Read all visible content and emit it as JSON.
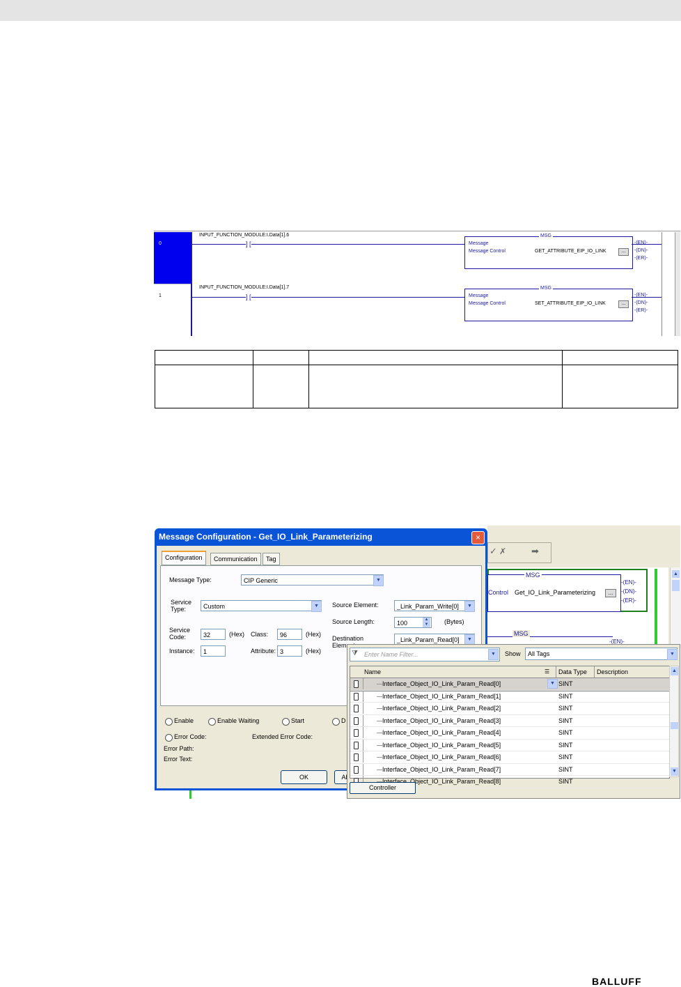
{
  "ladder": {
    "rungs": [
      {
        "number": "0",
        "contact": "INPUT_FUNCTION_MODULE:I.Data[1].6",
        "instr": "MSG",
        "l1": "Message",
        "l2": "Message Control",
        "tag": "GET_ATTRIBUTE_EIP_IO_LINK",
        "btn": "...",
        "outs": [
          "EN",
          "DN",
          "ER"
        ]
      },
      {
        "number": "1",
        "contact": "INPUT_FUNCTION_MODULE:I.Data[1].7",
        "instr": "MSG",
        "l1": "Message",
        "l2": "Message Control",
        "tag": "SET_ATTRIBUTE_EIP_IO_LINK",
        "btn": "...",
        "outs": [
          "EN",
          "DN",
          "ER"
        ]
      }
    ]
  },
  "dialog": {
    "title": "Message Configuration - Get_IO_Link_Parameterizing",
    "close": "×",
    "tabs": [
      "Configuration",
      "Communication",
      "Tag"
    ],
    "message_type_label": "Message Type:",
    "message_type_value": "CIP Generic",
    "service_type_label_1": "Service",
    "service_type_label_2": "Type:",
    "service_type_value": "Custom",
    "service_code_label_1": "Service",
    "service_code_label_2": "Code:",
    "service_code_value": "32",
    "hex1": "(Hex)",
    "class_label": "Class:",
    "class_value": "96",
    "hex2": "(Hex)",
    "instance_label": "Instance:",
    "instance_value": "1",
    "attribute_label": "Attribute:",
    "attribute_value": "3",
    "hex3": "(Hex)",
    "source_element_label": "Source Element:",
    "source_element_value": "_Link_Param_Write[0]",
    "source_length_label": "Source Length:",
    "source_length_value": "100",
    "bytes_label": "(Bytes)",
    "dest_label_1": "Destination",
    "dest_label_2": "Element:",
    "dest_value": "_Link_Param_Read[0]",
    "status": [
      "Enable",
      "Enable Waiting",
      "Start",
      "D"
    ],
    "error_code_label": "Error Code:",
    "extended_error_label": "Extended Error Code:",
    "error_path_label": "Error Path:",
    "error_text_label": "Error Text:",
    "ok": "OK",
    "abort": "Ab"
  },
  "bg_ladder": {
    "msg": "MSG",
    "control": "Control",
    "tag": "Get_IO_Link_Parameterizing",
    "btn": "...",
    "outs": [
      "EN",
      "DN",
      "ER"
    ],
    "msg2": "MSG",
    "out2": "EN"
  },
  "browser": {
    "filter_placeholder": "Enter Name Filter...",
    "show_label": "Show",
    "show_value": "All Tags",
    "headers": [
      "Name",
      "Data Type",
      "Description"
    ],
    "rows": [
      {
        "name": "Interface_Object_IO_Link_Param_Read[0]",
        "type": "SINT"
      },
      {
        "name": "Interface_Object_IO_Link_Param_Read[1]",
        "type": "SINT"
      },
      {
        "name": "Interface_Object_IO_Link_Param_Read[2]",
        "type": "SINT"
      },
      {
        "name": "Interface_Object_IO_Link_Param_Read[3]",
        "type": "SINT"
      },
      {
        "name": "Interface_Object_IO_Link_Param_Read[4]",
        "type": "SINT"
      },
      {
        "name": "Interface_Object_IO_Link_Param_Read[5]",
        "type": "SINT"
      },
      {
        "name": "Interface_Object_IO_Link_Param_Read[6]",
        "type": "SINT"
      },
      {
        "name": "Interface_Object_IO_Link_Param_Read[7]",
        "type": "SINT"
      },
      {
        "name": "Interface_Object_IO_Link_Param_Read[8]",
        "type": "SINT"
      }
    ],
    "scope_button": "Controller"
  },
  "footer": {
    "brand": "BALLUFF"
  }
}
